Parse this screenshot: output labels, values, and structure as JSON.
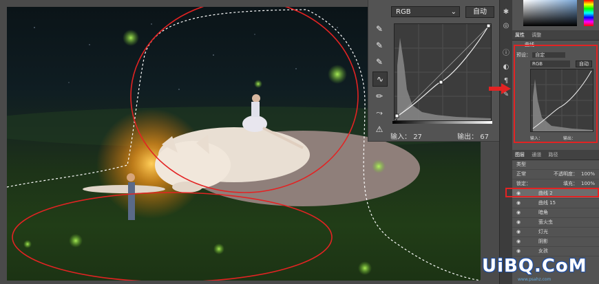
{
  "curves_dialog": {
    "channel": "RGB",
    "auto_label": "自动",
    "input_label": "输入：",
    "input_value": "27",
    "output_label": "输出：",
    "output_value": "67"
  },
  "properties_panel": {
    "tabs": [
      "属性",
      "调整"
    ],
    "preset_label": "预设：",
    "preset_value": "自定",
    "channel": "RGB",
    "auto_label": "自动",
    "layer_type": "曲线",
    "input_label": "输入：",
    "output_label": "输出："
  },
  "layers_panel": {
    "tabs": [
      "图层",
      "通道",
      "路径"
    ],
    "filter_kind": "类型",
    "blend_mode": "正常",
    "opacity_label": "不透明度：",
    "opacity_value": "100%",
    "lock_label": "锁定：",
    "fill_label": "填充：",
    "fill_value": "100%",
    "rows": [
      {
        "name": "曲线 2",
        "selected": true
      },
      {
        "name": "曲线 15",
        "selected": false
      },
      {
        "name": "暗角",
        "selected": false
      },
      {
        "name": "萤火虫",
        "selected": false
      },
      {
        "name": "灯光",
        "selected": false
      },
      {
        "name": "阴影",
        "selected": false
      },
      {
        "name": "女孩",
        "selected": false
      }
    ]
  },
  "watermark": {
    "text": "UiBQ.CoM",
    "sub": "www.psahz.com"
  },
  "colors": {
    "accent_red": "#e32323",
    "panel_bg": "#535353",
    "dark_bg": "#3c3c3c"
  }
}
